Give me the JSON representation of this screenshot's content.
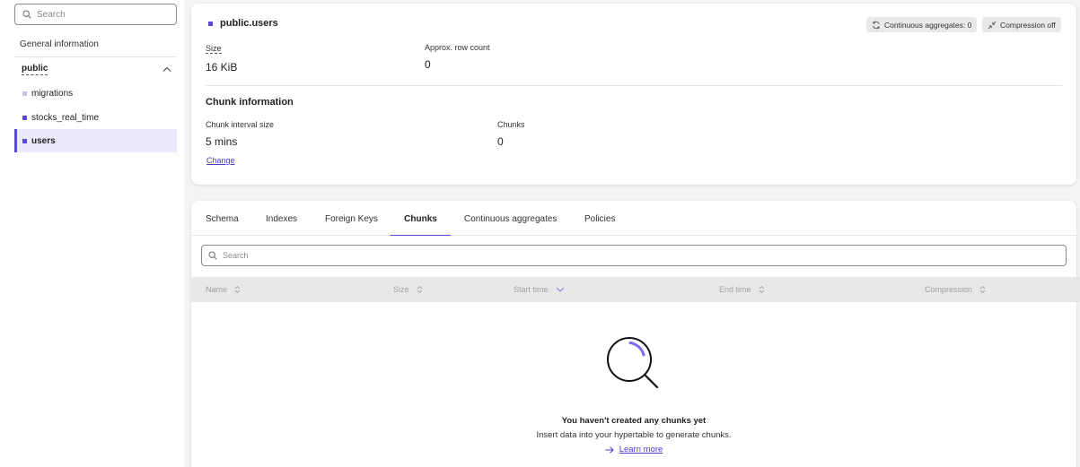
{
  "sidebar": {
    "search": {
      "placeholder": "Search"
    },
    "general_info": "General information",
    "schema": "public",
    "items": [
      {
        "label": "migrations",
        "color": "#c7c2ef"
      },
      {
        "label": "stocks_real_time",
        "color": "#5b47d9"
      },
      {
        "label": "users",
        "color": "#5b47d9",
        "active": true
      }
    ]
  },
  "header": {
    "title": "public.users",
    "badges": {
      "continuous_aggregates": "Continuous aggregates: 0",
      "compression": "Compression off"
    }
  },
  "stats": {
    "size_label": "Size",
    "size_value": "16 KiB",
    "rowcount_label": "Approx. row count",
    "rowcount_value": "0"
  },
  "chunk_info": {
    "title": "Chunk information",
    "interval_label": "Chunk interval size",
    "interval_value": "5 mins",
    "change_label": "Change",
    "chunks_label": "Chunks",
    "chunks_value": "0"
  },
  "tabs": [
    "Schema",
    "Indexes",
    "Foreign Keys",
    "Chunks",
    "Continuous aggregates",
    "Policies"
  ],
  "active_tab": "Chunks",
  "table": {
    "search_placeholder": "Search",
    "columns": [
      "Name",
      "Size",
      "Start time",
      "End time",
      "Compression"
    ]
  },
  "empty_state": {
    "title": "You haven't created any chunks yet",
    "subtitle": "Insert data into your hypertable to generate chunks.",
    "link": "Learn more"
  },
  "colors": {
    "accent": "#5b47d9"
  }
}
